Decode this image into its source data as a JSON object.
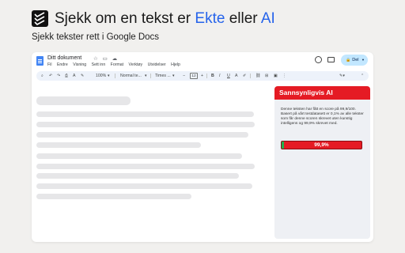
{
  "hero": {
    "title_pre": "Sjekk om en tekst er ",
    "title_accent1": "Ekte",
    "title_mid": " eller ",
    "title_accent2": "AI",
    "subtitle": "Sjekk tekster rett i Google Docs",
    "accent_color": "#2563eb"
  },
  "docs": {
    "doc_title": "Ditt dokument",
    "title_icons": [
      "star-icon",
      "folder-move-icon",
      "cloud-icon"
    ],
    "menu": [
      "Fil",
      "Endre",
      "Visning",
      "Sett inn",
      "Format",
      "Verktøy",
      "Utvidelser",
      "Hjelp"
    ],
    "share_label": "Del",
    "toolbar": {
      "zoom": "100%",
      "style": "Normal te...",
      "font": "Times ...",
      "font_size": "12"
    }
  },
  "panel": {
    "header": "Sannsynligvis AI",
    "description": "Denne teksten har fått en score på 99,9/100. Basert på vårt testdatasett er 0,1% av alle tekster som får denne scoren skrevet uten kunstig intelligens og 99,9% skrevet med.",
    "score_label": "99,9%",
    "ai_probability": 0.999,
    "header_color": "#e51b24",
    "human_color": "#22b14c"
  }
}
